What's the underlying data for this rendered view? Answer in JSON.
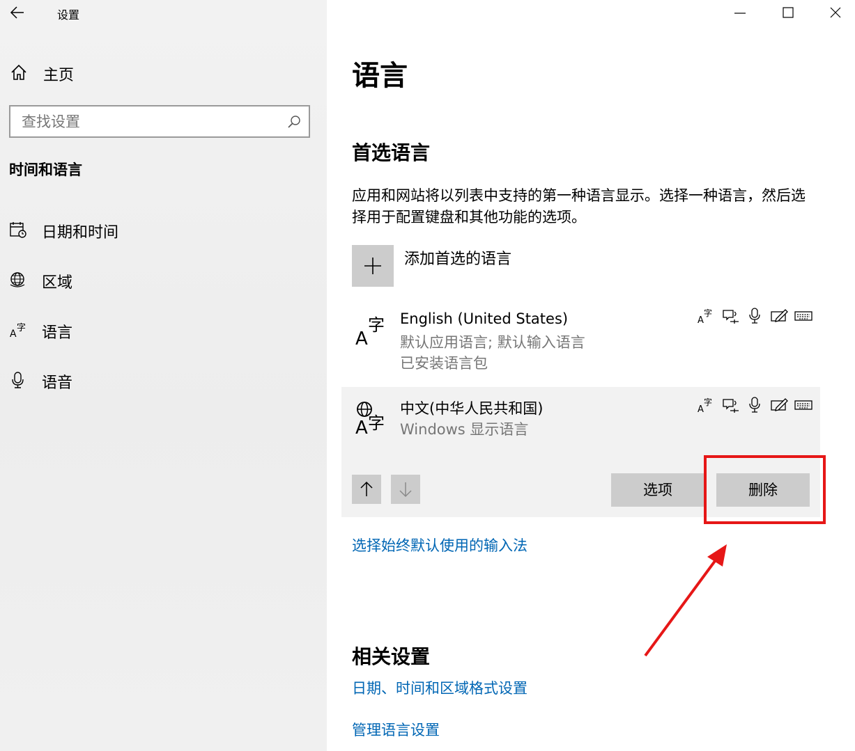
{
  "window": {
    "app_title": "设置",
    "back_icon": "back-arrow-icon",
    "controls": [
      "minimize-icon",
      "maximize-icon",
      "close-icon"
    ]
  },
  "sidebar": {
    "home_label": "主页",
    "search_placeholder": "查找设置",
    "section_title": "时间和语言",
    "items": [
      {
        "label": "日期和时间",
        "icon": "calendar-clock-icon"
      },
      {
        "label": "区域",
        "icon": "globe-region-icon"
      },
      {
        "label": "语言",
        "icon": "language-icon"
      },
      {
        "label": "语音",
        "icon": "microphone-icon"
      }
    ]
  },
  "main": {
    "title": "语言",
    "preferred_heading": "首选语言",
    "description": "应用和网站将以列表中支持的第一种语言显示。选择一种语言，然后选择用于配置键盘和其他功能的选项。",
    "add_language_label": "添加首选的语言",
    "languages": [
      {
        "name": "English (United States)",
        "line1": "默认应用语言; 默认输入语言",
        "line2": "已安装语言包",
        "icon": "language-a-zi-icon"
      },
      {
        "name": "中文(中华人民共和国)",
        "line1": "Windows 显示语言",
        "icon": "display-language-globe-icon",
        "selected": true
      }
    ],
    "feature_icons": [
      "language-pack-icon",
      "text-to-speech-icon",
      "speech-recognition-icon",
      "handwriting-icon",
      "keyboard-icon"
    ],
    "options_button": "选项",
    "remove_button": "删除",
    "input_method_link": "选择始终默认使用的输入法",
    "related_heading": "相关设置",
    "related_links": [
      "日期、时间和区域格式设置",
      "管理语言设置"
    ]
  },
  "colors": {
    "accent_link": "#0066b4",
    "highlight": "#e61717",
    "button_bg": "#cccccc",
    "sidebar_bg": "#f0f0f0"
  }
}
